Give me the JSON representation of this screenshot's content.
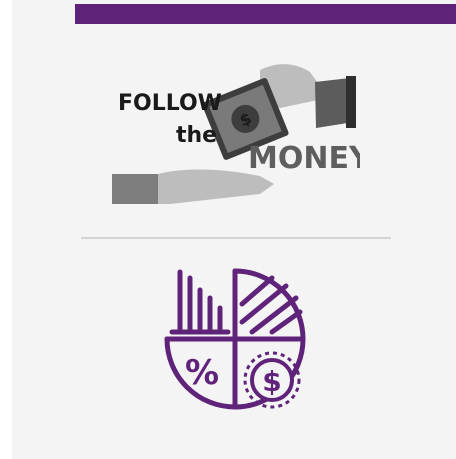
{
  "header": {
    "bar_color": "#60237a"
  },
  "logo": {
    "line1": "FOLLOW",
    "line2": "the",
    "line3": "MONEY",
    "bill_symbol": "$",
    "icon": "hands-passing-cash-icon"
  },
  "finance_icon": {
    "name": "pie-chart-finance-icon",
    "color": "#60237a",
    "percent_symbol": "%",
    "currency_symbol": "$"
  }
}
